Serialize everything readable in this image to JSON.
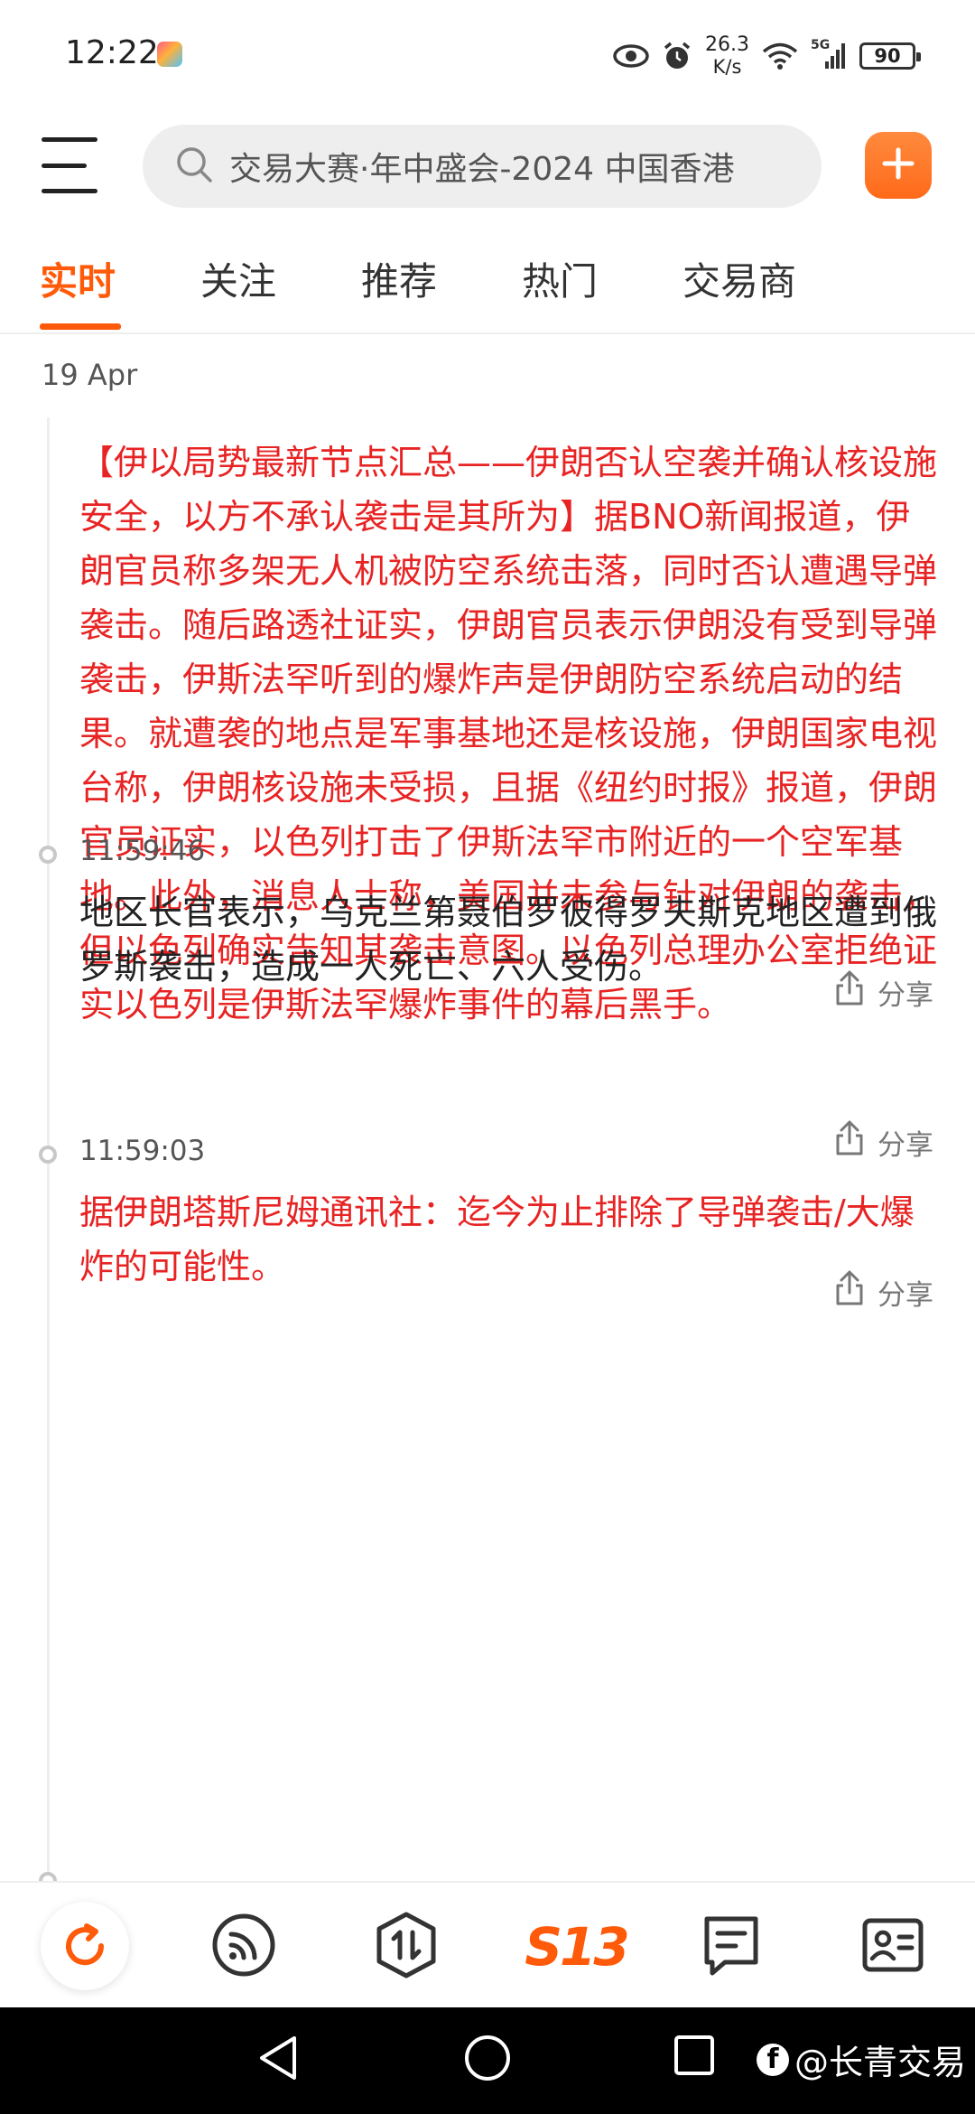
{
  "status_bar": {
    "time": "12:22",
    "net_speed_value": "26.3",
    "net_speed_unit": "K/s",
    "signal_label": "5G",
    "battery": "90"
  },
  "search": {
    "placeholder": "交易大赛·年中盛会-2024 中国香港"
  },
  "tabs": [
    {
      "label": "实时",
      "active": true
    },
    {
      "label": "关注"
    },
    {
      "label": "推荐"
    },
    {
      "label": "热门"
    },
    {
      "label": "交易商"
    }
  ],
  "feed": {
    "date": "19 Apr",
    "items": [
      {
        "time": "",
        "text": "【伊以局势最新节点汇总——伊朗否认空袭并确认核设施安全，以方不承认袭击是其所为】据BNO新闻报道，伊朗官员称多架无人机被防空系统击落，同时否认遭遇导弹袭击。随后路透社证实，伊朗官员表示伊朗没有受到导弹袭击，伊斯法罕听到的爆炸声是伊朗防空系统启动的结果。就遭袭的地点是军事基地还是核设施，伊朗国家电视台称，伊朗核设施未受损，且据《纽约时报》报道，伊朗官员证实，以色列打击了伊斯法罕市附近的一个空军基地。此外，消息人士称，美国并未参与针对伊朗的袭击，但以色列确实告知其袭击意图。以色列总理办公室拒绝证实以色列是伊斯法罕爆炸事件的幕后黑手。",
        "important": true,
        "share_label": "分享"
      },
      {
        "time": "11:59:46",
        "text": "地区长官表示，乌克兰第聂伯罗彼得罗夫斯克地区遭到俄罗斯袭击，造成一人死亡、六人受伤。",
        "important": false,
        "share_label": "分享"
      },
      {
        "time": "11:59:03",
        "text": "据伊朗塔斯尼姆通讯社：迄今为止排除了导弹袭击/大爆炸的可能性。",
        "important": true,
        "share_label": "分享"
      }
    ]
  },
  "bottom_nav": {
    "items": [
      {
        "icon": "refresh-icon"
      },
      {
        "icon": "podcast-icon"
      },
      {
        "icon": "exchange-icon"
      },
      {
        "icon": "s13-logo",
        "label": "S13"
      },
      {
        "icon": "message-icon"
      },
      {
        "icon": "profile-card-icon"
      }
    ]
  },
  "watermark": {
    "text": "@长青交易"
  },
  "colors": {
    "accent": "#ff5a0a",
    "important_text": "#e82323"
  }
}
